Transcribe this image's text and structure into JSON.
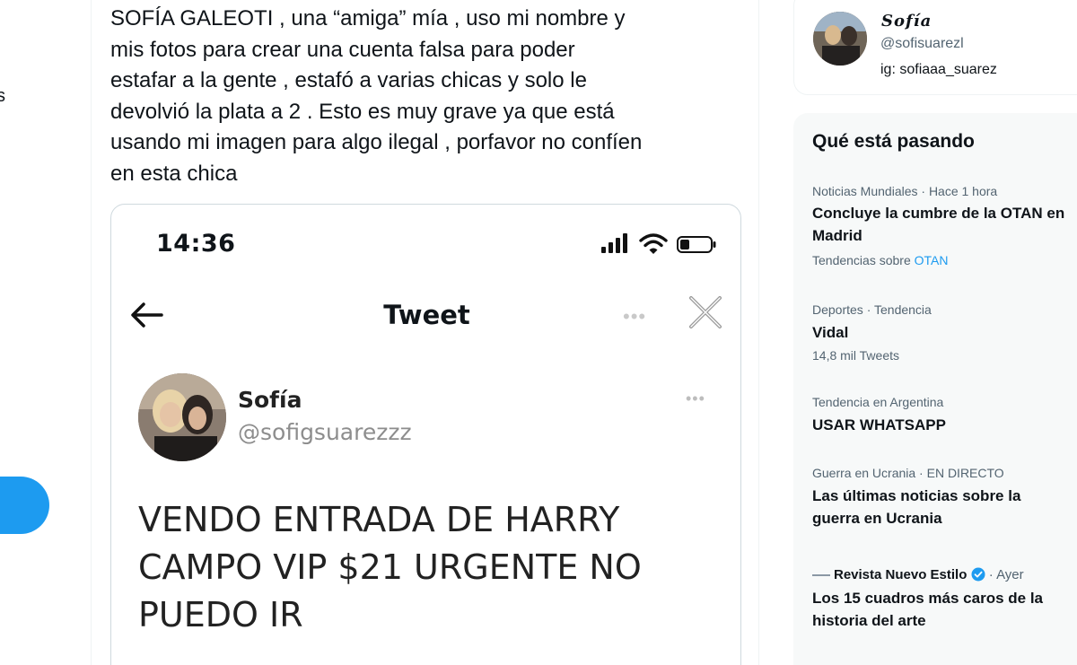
{
  "sidebar": {
    "cut_text": "s"
  },
  "tweet": {
    "text": "SOFÍA GALEOTI , una “amiga” mía , uso mi nombre y\nmis fotos para crear una cuenta falsa para poder\nestafar a la gente , estafó a varias chicas y solo le\ndevolvió la plata a 2  . Esto es muy grave ya que está\nusando mi imagen para algo ilegal , porfavor no confíen\nen esta chica"
  },
  "screenshot": {
    "time": "14:36",
    "title": "Tweet",
    "name": "Sofía",
    "handle": "@sofigsuarezzz",
    "text": "VENDO ENTRADA DE HARRY\nCAMPO VIP $21 URGENTE NO\nPUEDO IR"
  },
  "profile": {
    "name": "Sofía",
    "handle": "@sofisuarezl",
    "bio": "ig: sofiaaa_suarez"
  },
  "trends": {
    "title": "Qué está pasando",
    "items": [
      {
        "meta": "Noticias Mundiales · Hace 1 hora",
        "title": "Concluye la cumbre de la OTAN en Madrid",
        "sub_prefix": "Tendencias sobre ",
        "sub_link": "OTAN"
      },
      {
        "meta": "Deportes · Tendencia",
        "title": "Vidal",
        "sub": "14,8 mil Tweets"
      },
      {
        "meta": "Tendencia en Argentina",
        "title": "USAR WHATSAPP"
      },
      {
        "meta": "Guerra en Ucrania · EN DIRECTO",
        "title": "Las últimas noticias sobre la guerra en Ucrania"
      },
      {
        "source": "Revista Nuevo Estilo",
        "time": "· Ayer",
        "title": "Los 15 cuadros más caros de la historia del arte"
      }
    ]
  },
  "colors": {
    "accent": "#1d9bf0",
    "text": "#0f1419",
    "muted": "#536471",
    "trends_bg": "#f7f9f9"
  }
}
